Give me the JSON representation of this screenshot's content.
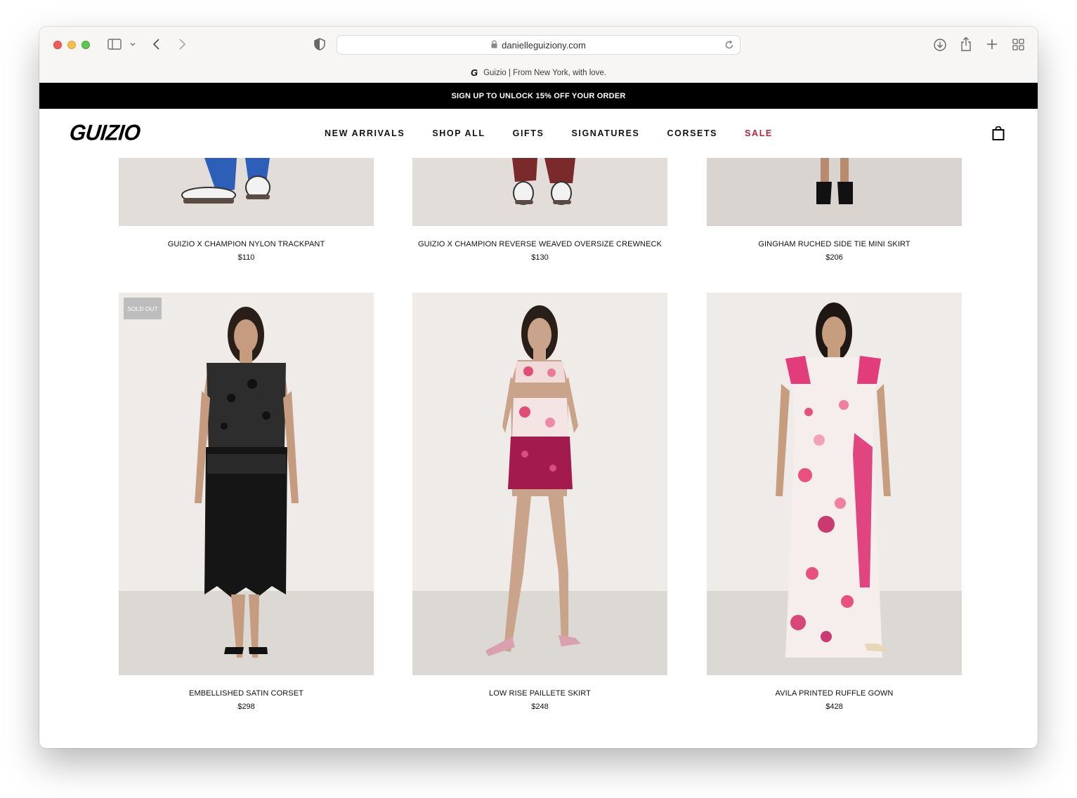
{
  "browser": {
    "url": "danielleguiziony.com",
    "tab_favicon": "G",
    "tab_title": "Guizio | From New York, with love."
  },
  "promo_banner": "SIGN UP TO UNLOCK 15% OFF YOUR ORDER",
  "header": {
    "logo": "GUIZIO",
    "nav": [
      {
        "label": "NEW ARRIVALS"
      },
      {
        "label": "SHOP ALL"
      },
      {
        "label": "GIFTS"
      },
      {
        "label": "SIGNATURES"
      },
      {
        "label": "CORSETS"
      },
      {
        "label": "SALE"
      }
    ],
    "sale_color": "#b2253b"
  },
  "products": [
    {
      "name": "GUIZIO X CHAMPION NYLON TRACKPANT",
      "price": "$110"
    },
    {
      "name": "GUIZIO X CHAMPION REVERSE WEAVED OVERSIZE CREWNECK",
      "price": "$130"
    },
    {
      "name": "GINGHAM RUCHED SIDE TIE MINI SKIRT",
      "price": "$206"
    },
    {
      "name": "EMBELLISHED SATIN CORSET",
      "price": "$298",
      "badge": "SOLD OUT"
    },
    {
      "name": "LOW RISE PAILLETE SKIRT",
      "price": "$248"
    },
    {
      "name": "AVILA PRINTED RUFFLE GOWN",
      "price": "$428"
    }
  ]
}
